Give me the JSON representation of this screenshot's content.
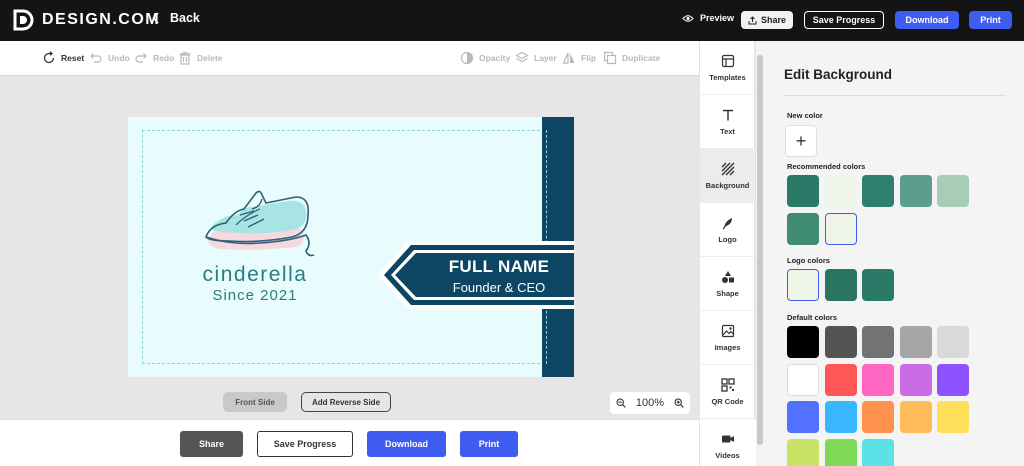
{
  "app": {
    "logo_text": "DESIGN.COM",
    "back_label": "Back",
    "preview_label": "Preview",
    "share_label": "Share",
    "save_progress_label": "Save Progress",
    "download_label": "Download",
    "print_label": "Print"
  },
  "toolbar": {
    "reset": "Reset",
    "undo": "Undo",
    "redo": "Redo",
    "delete": "Delete",
    "opacity": "Opacity",
    "layer": "Layer",
    "flip": "Flip",
    "duplicate": "Duplicate"
  },
  "card": {
    "brand_name": "cinderella",
    "brand_since": "Since 2021",
    "full_name": "FULL NAME",
    "job_title": "Founder & CEO"
  },
  "canvas": {
    "front_side": "Front Side",
    "add_reverse_side": "Add Reverse Side",
    "zoom_level": "100%"
  },
  "bottom": {
    "share": "Share",
    "save_progress": "Save Progress",
    "download": "Download",
    "print": "Print"
  },
  "sidenav": {
    "templates": "Templates",
    "text": "Text",
    "background": "Background",
    "logo": "Logo",
    "shape": "Shape",
    "images": "Images",
    "qr_code": "QR Code",
    "videos": "Videos"
  },
  "panel": {
    "title": "Edit Background",
    "new_color_label": "New color",
    "recommended_label": "Recommended colors",
    "logo_colors_label": "Logo colors",
    "default_colors_label": "Default colors",
    "recommended_colors": [
      "#2b7a68",
      "#eef5e6",
      "#2d7f6f",
      "#5c9e8e",
      "#a7cdb9",
      "#3f8c72",
      "#eef5e6"
    ],
    "logo_colors": [
      "#eef5e6",
      "#2a7560",
      "#2b7a68"
    ],
    "default_colors": [
      "#000000",
      "#545454",
      "#737373",
      "#a6a6a6",
      "#d9d9d9",
      "#ffffff",
      "#ff5757",
      "#ff66c4",
      "#cb6ce6",
      "#8c52ff",
      "#5271ff",
      "#38b6ff",
      "#ff914d",
      "#ffbd59",
      "#ffde59",
      "#c9e265",
      "#7ed957",
      "#5ce1e6"
    ]
  },
  "colors": {
    "accent": "#3f5cf0",
    "topbar": "#141414",
    "card_background": "#e8fbfd",
    "card_navy": "#0c4663",
    "brand_teal": "#2a7c7f"
  }
}
